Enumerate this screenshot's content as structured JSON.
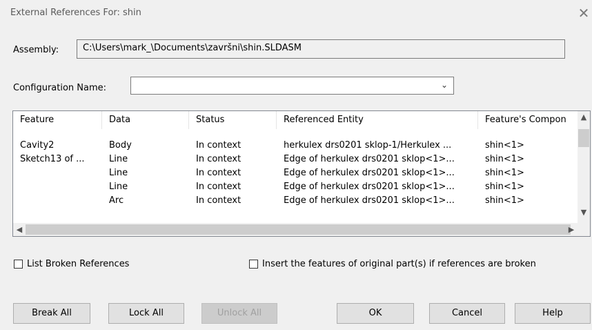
{
  "window": {
    "title": "External References For: shin",
    "close_glyph": "✕"
  },
  "assembly": {
    "label": "Assembly:",
    "value": "C:\\Users\\mark_\\Documents\\završni\\shin.SLDASM"
  },
  "configuration": {
    "label": "Configuration Name:",
    "value": ""
  },
  "table": {
    "columns": [
      "Feature",
      "Data",
      "Status",
      "Referenced Entity",
      "Feature's Compon"
    ],
    "rows": [
      [
        "Cavity2",
        "Body",
        "In context",
        "herkulex drs0201 sklop-1/Herkulex ...",
        "shin<1>"
      ],
      [
        "Sketch13  of ...",
        "Line",
        "In context",
        "Edge of herkulex drs0201 sklop<1>...",
        "shin<1>"
      ],
      [
        "",
        "Line",
        "In context",
        "Edge of herkulex drs0201 sklop<1>...",
        "shin<1>"
      ],
      [
        "",
        "Line",
        "In context",
        "Edge of herkulex drs0201 sklop<1>...",
        "shin<1>"
      ],
      [
        "",
        "Arc",
        "In context",
        "Edge of herkulex drs0201 sklop<1>...",
        "shin<1>"
      ]
    ]
  },
  "options": {
    "list_broken": {
      "label": "List Broken References",
      "checked": false
    },
    "insert_features": {
      "label": "Insert the features of original part(s) if references are broken",
      "checked": false
    }
  },
  "buttons": {
    "break_all": "Break All",
    "lock_all": "Lock All",
    "unlock_all": "Unlock All",
    "ok": "OK",
    "cancel": "Cancel",
    "help": "Help"
  },
  "icons": {
    "close": "close-icon",
    "combo_arrow": "chevron-down-icon",
    "scroll_up": "chevron-up-icon",
    "scroll_down": "chevron-down-icon",
    "scroll_left": "chevron-left-icon",
    "scroll_right": "chevron-right-icon"
  }
}
